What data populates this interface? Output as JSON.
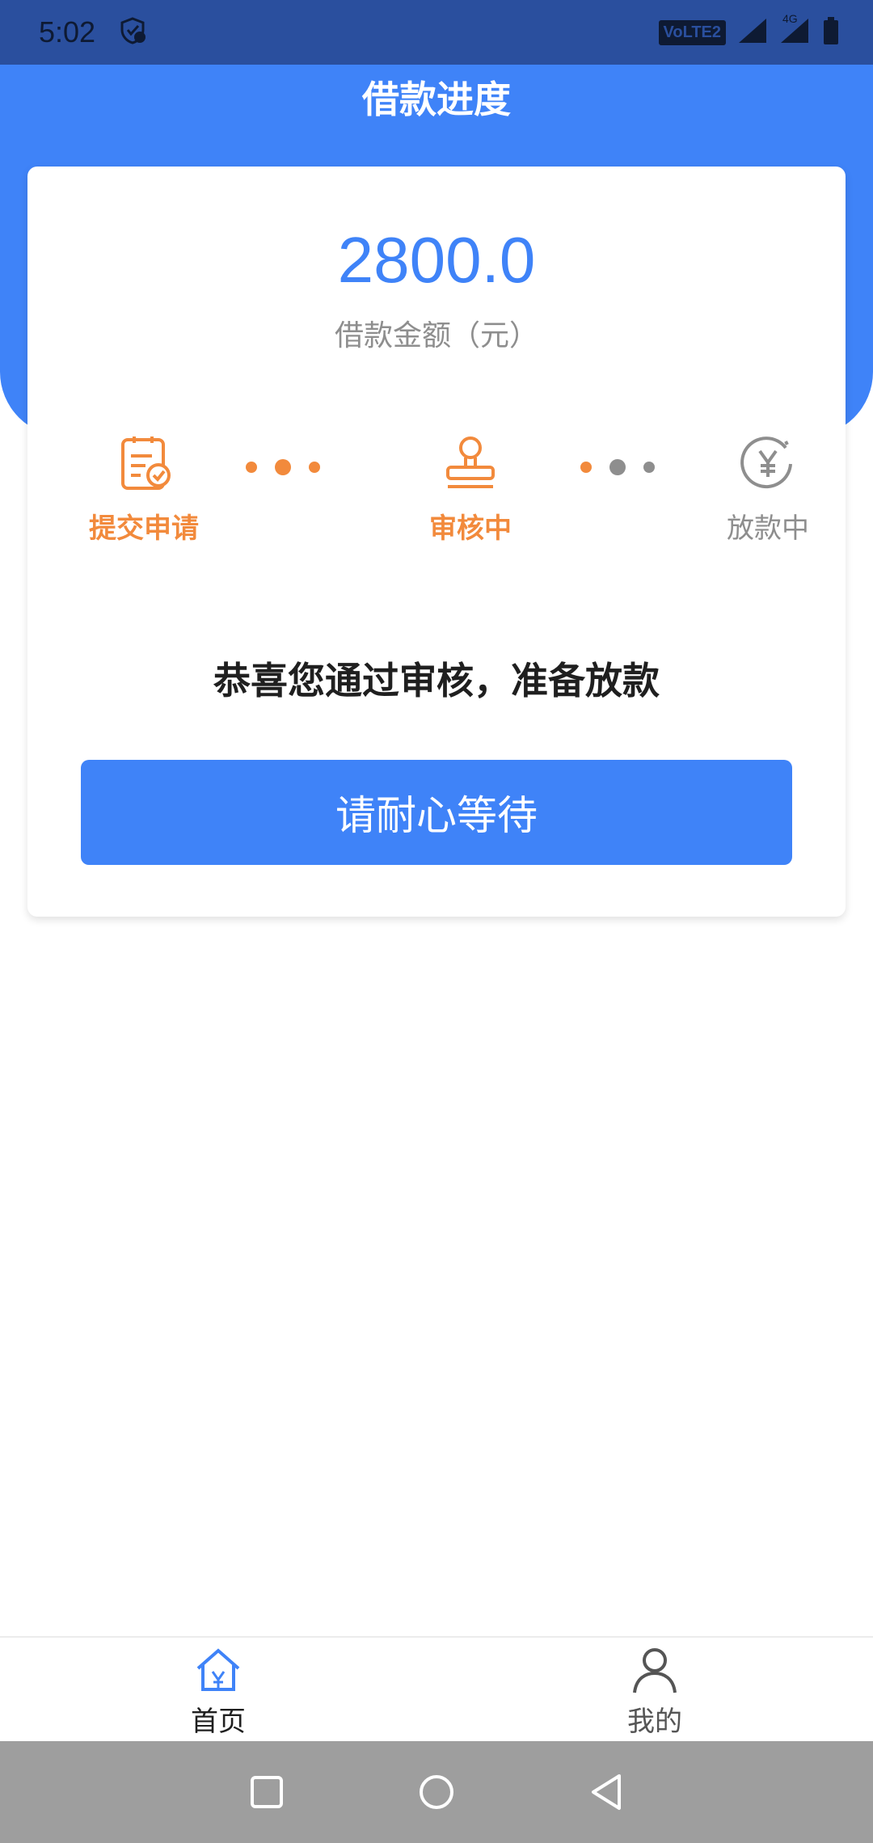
{
  "status_bar": {
    "time": "5:02",
    "network_badge": "VoLTE2",
    "network_type": "4G"
  },
  "header": {
    "title": "借款进度"
  },
  "loan": {
    "amount": "2800.0",
    "amount_label": "借款金额（元）"
  },
  "steps": [
    {
      "label": "提交申请",
      "icon": "document-check-icon",
      "state": "done"
    },
    {
      "label": "审核中",
      "icon": "stamp-icon",
      "state": "current"
    },
    {
      "label": "放款中",
      "icon": "yen-circle-icon",
      "state": "pending"
    }
  ],
  "message": "恭喜您通过审核，准备放款",
  "wait_button_label": "请耐心等待",
  "bottom_nav": {
    "items": [
      {
        "label": "首页",
        "icon": "home-yen-icon",
        "active": true
      },
      {
        "label": "我的",
        "icon": "person-icon",
        "active": false
      }
    ]
  },
  "colors": {
    "primary": "#3f83f8",
    "accent": "#f28a3c",
    "muted": "#8e8e8e",
    "status_bar": "#2a4f9e"
  }
}
